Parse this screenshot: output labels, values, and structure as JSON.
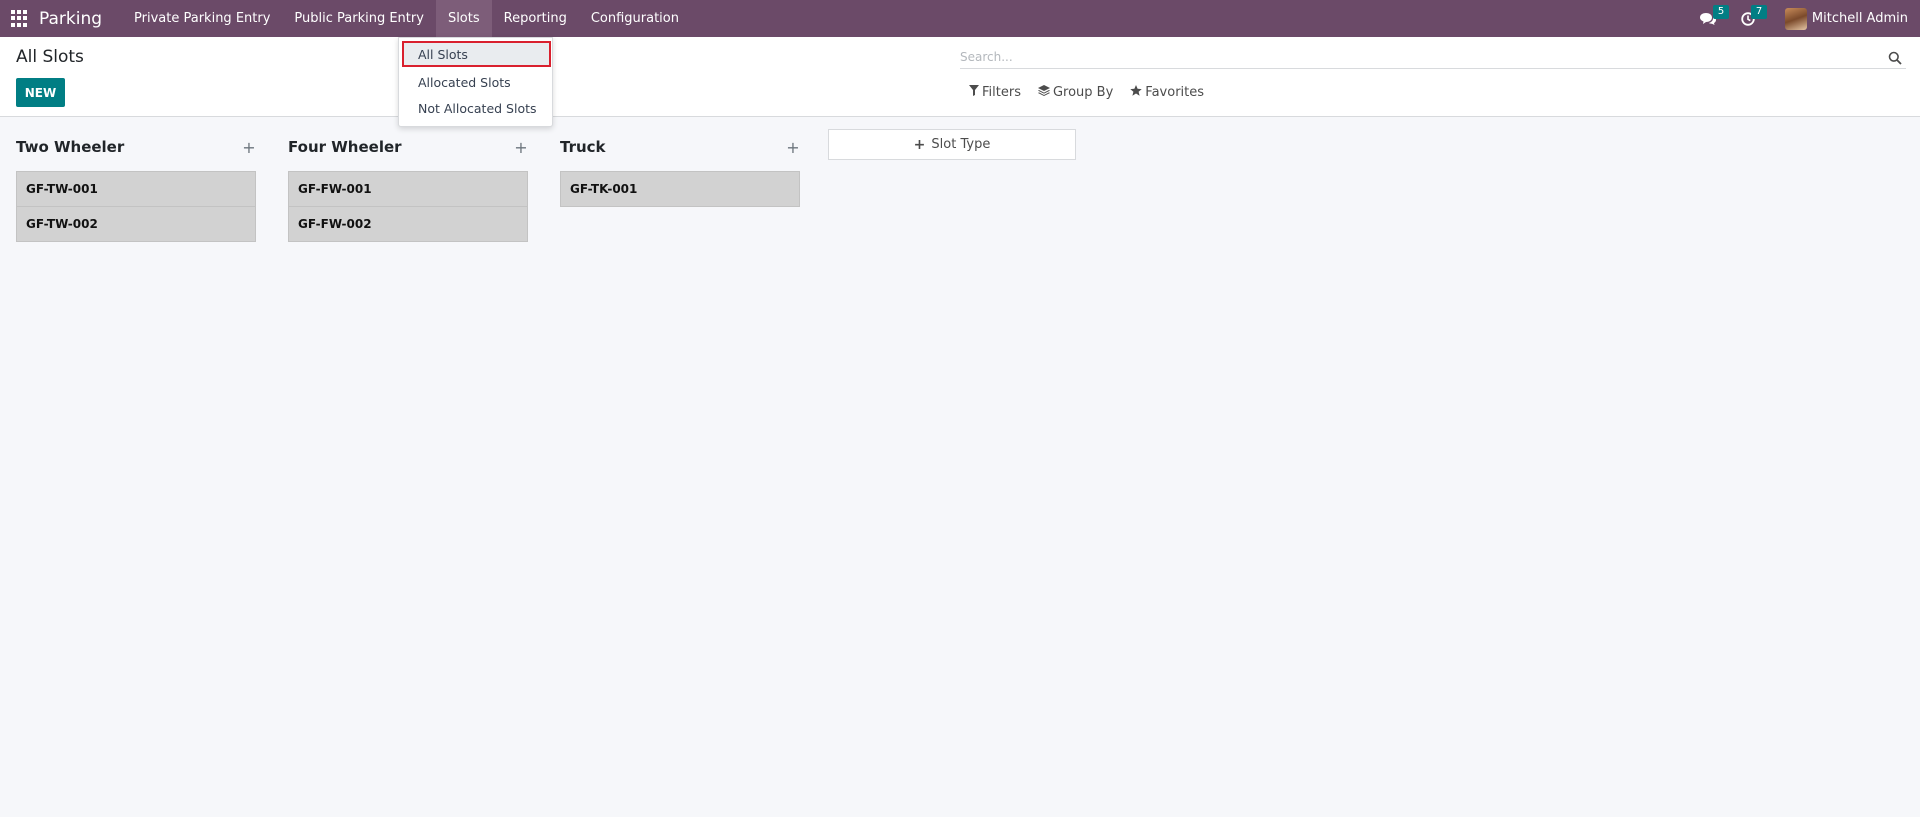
{
  "navbar": {
    "brand": "Parking",
    "menu": [
      {
        "label": "Private Parking Entry"
      },
      {
        "label": "Public Parking Entry"
      },
      {
        "label": "Slots"
      },
      {
        "label": "Reporting"
      },
      {
        "label": "Configuration"
      }
    ],
    "messages_count": "5",
    "activities_count": "7",
    "user_name": "Mitchell Admin",
    "colors": {
      "navbar_bg": "#6b4a68",
      "badge": "#017e84"
    }
  },
  "dropdown": {
    "items": [
      {
        "label": "All Slots"
      },
      {
        "label": "Allocated Slots"
      },
      {
        "label": "Not Allocated Slots"
      }
    ]
  },
  "control_panel": {
    "title": "All Slots",
    "new_label": "NEW",
    "search_placeholder": "Search...",
    "filters_label": "Filters",
    "groupby_label": "Group By",
    "favorites_label": "Favorites"
  },
  "kanban": {
    "columns": [
      {
        "title": "Two Wheeler",
        "cards": [
          "GF-TW-001",
          "GF-TW-002"
        ]
      },
      {
        "title": "Four Wheeler",
        "cards": [
          "GF-FW-001",
          "GF-FW-002"
        ]
      },
      {
        "title": "Truck",
        "cards": [
          "GF-TK-001"
        ]
      }
    ],
    "add_column_label": "Slot Type"
  }
}
